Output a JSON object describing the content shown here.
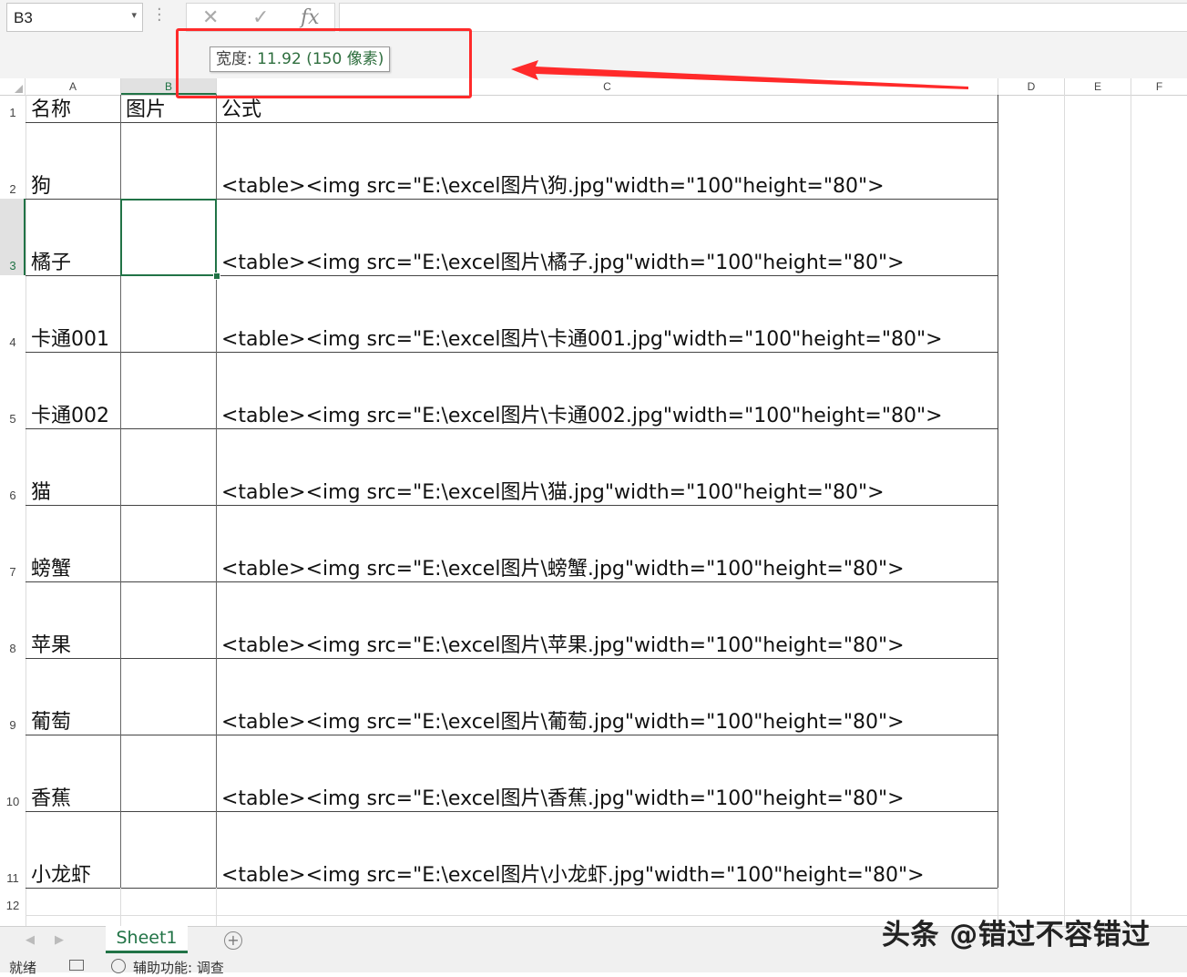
{
  "namebox": {
    "value": "B3",
    "arrow": "▾"
  },
  "formula_bar": {
    "cancel_icon": "✕",
    "enter_icon": "✓",
    "fx_label": "fx",
    "value": ""
  },
  "tooltip": {
    "label": "宽度:",
    "value": " 11.92 (150 像素)"
  },
  "columns": [
    "A",
    "B",
    "C",
    "D",
    "E",
    "F"
  ],
  "selected_cell": "B3",
  "rows": [
    {
      "num": "1",
      "name": "名称",
      "pic": "图片",
      "formula": "公式"
    },
    {
      "num": "2",
      "name": "狗",
      "pic": "",
      "formula": "<table><img src=\"E:\\excel图片\\狗.jpg\"width=\"100\"height=\"80\">"
    },
    {
      "num": "3",
      "name": "橘子",
      "pic": "",
      "formula": "<table><img src=\"E:\\excel图片\\橘子.jpg\"width=\"100\"height=\"80\">"
    },
    {
      "num": "4",
      "name": "卡通001",
      "pic": "",
      "formula": "<table><img src=\"E:\\excel图片\\卡通001.jpg\"width=\"100\"height=\"80\">"
    },
    {
      "num": "5",
      "name": "卡通002",
      "pic": "",
      "formula": "<table><img src=\"E:\\excel图片\\卡通002.jpg\"width=\"100\"height=\"80\">"
    },
    {
      "num": "6",
      "name": "猫",
      "pic": "",
      "formula": "<table><img src=\"E:\\excel图片\\猫.jpg\"width=\"100\"height=\"80\">"
    },
    {
      "num": "7",
      "name": "螃蟹",
      "pic": "",
      "formula": "<table><img src=\"E:\\excel图片\\螃蟹.jpg\"width=\"100\"height=\"80\">"
    },
    {
      "num": "8",
      "name": "苹果",
      "pic": "",
      "formula": "<table><img src=\"E:\\excel图片\\苹果.jpg\"width=\"100\"height=\"80\">"
    },
    {
      "num": "9",
      "name": "葡萄",
      "pic": "",
      "formula": "<table><img src=\"E:\\excel图片\\葡萄.jpg\"width=\"100\"height=\"80\">"
    },
    {
      "num": "10",
      "name": "香蕉",
      "pic": "",
      "formula": "<table><img src=\"E:\\excel图片\\香蕉.jpg\"width=\"100\"height=\"80\">"
    },
    {
      "num": "11",
      "name": "小龙虾",
      "pic": "",
      "formula": "<table><img src=\"E:\\excel图片\\小龙虾.jpg\"width=\"100\"height=\"80\">"
    },
    {
      "num": "12",
      "name": "",
      "pic": "",
      "formula": ""
    }
  ],
  "sheet_tabs": [
    "Sheet1"
  ],
  "add_sheet_icon": "+",
  "nav": {
    "prev": "◀",
    "next": "▶"
  },
  "status": {
    "ready": "就绪",
    "accessibility": "辅助功能: 调查"
  },
  "watermark": "头条 @错过不容错过",
  "colors": {
    "accent_green": "#217346",
    "annotation_red": "#ff2a2a"
  }
}
